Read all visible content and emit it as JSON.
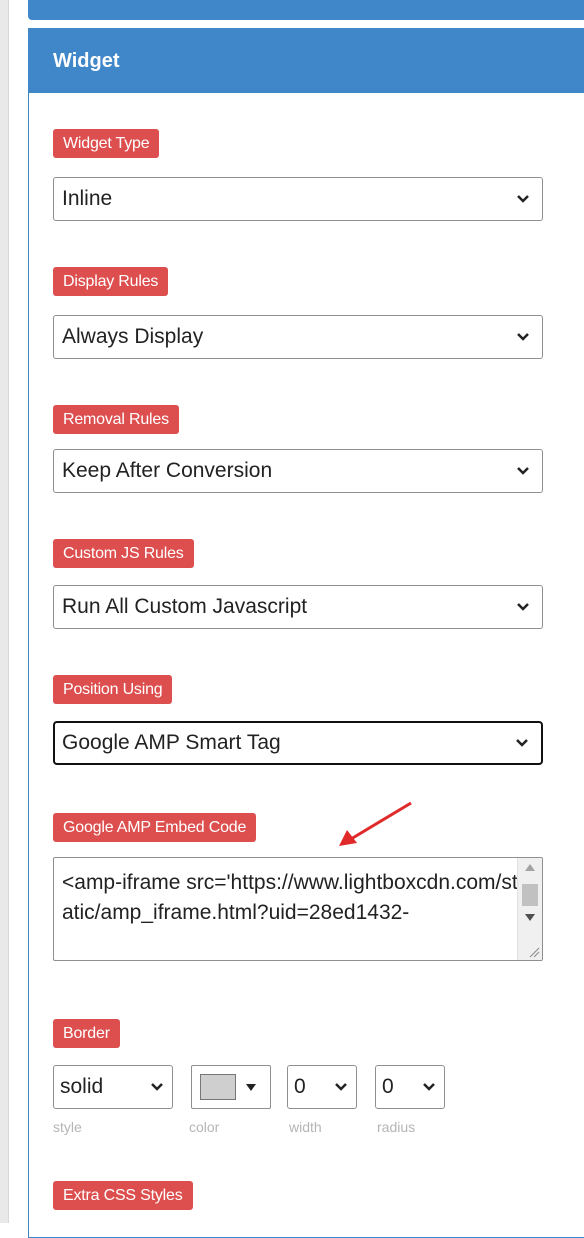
{
  "panel": {
    "title": "Widget"
  },
  "fields": {
    "widget_type": {
      "label": "Widget Type",
      "value": "Inline"
    },
    "display_rules": {
      "label": "Display Rules",
      "value": "Always Display"
    },
    "removal_rules": {
      "label": "Removal Rules",
      "value": "Keep After Conversion"
    },
    "custom_js_rules": {
      "label": "Custom JS Rules",
      "value": "Run All Custom Javascript"
    },
    "position_using": {
      "label": "Position Using",
      "value": "Google AMP Smart Tag"
    },
    "amp_embed": {
      "label": "Google AMP Embed Code",
      "value": "<amp-iframe src='https://www.lightboxcdn.com/static/amp_iframe.html?uid=28ed1432-"
    },
    "border": {
      "label": "Border",
      "style_value": "solid",
      "style_caption": "style",
      "color_caption": "color",
      "width_value": "0",
      "width_caption": "width",
      "radius_value": "0",
      "radius_caption": "radius"
    },
    "extra_css": {
      "label": "Extra CSS Styles"
    }
  },
  "colors": {
    "header_blue": "#3f87c9",
    "label_red": "#dd4f4f",
    "arrow_red": "#e02a2a",
    "swatch_gray": "#cfcfcf"
  },
  "icons": [
    "chevron-down-icon",
    "red-arrow-icon",
    "resize-grip-icon"
  ]
}
